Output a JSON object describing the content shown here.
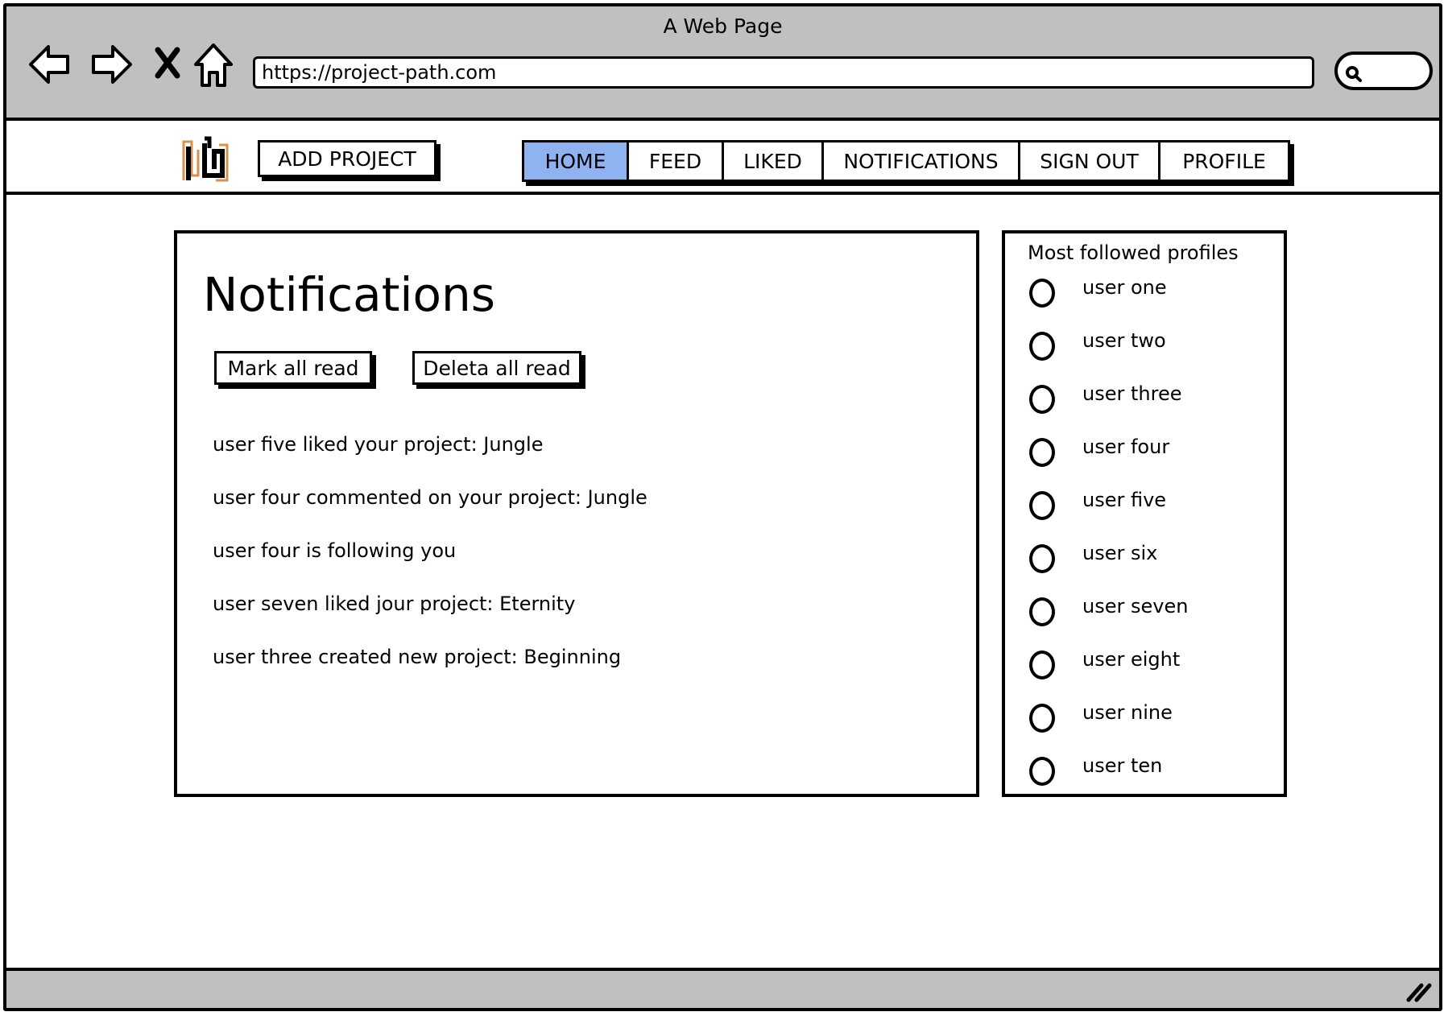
{
  "window": {
    "title": "A Web Page"
  },
  "browser": {
    "back_icon": "back-arrow-icon",
    "forward_icon": "forward-arrow-icon",
    "stop_icon": "close-x-icon",
    "home_icon": "home-icon",
    "url": "https://project-path.com",
    "search_icon": "search-icon"
  },
  "header": {
    "logo": "logo-icon",
    "add_project": "ADD PROJECT",
    "nav": [
      {
        "label": "HOME",
        "active": true
      },
      {
        "label": "FEED",
        "active": false
      },
      {
        "label": "LIKED",
        "active": false
      },
      {
        "label": "NOTIFICATIONS",
        "active": false
      },
      {
        "label": "SIGN OUT",
        "active": false
      },
      {
        "label": "PROFILE",
        "active": false
      }
    ],
    "active_color": "#8fb3f0"
  },
  "main": {
    "title": "Notifications",
    "mark_all_read": "Mark all read",
    "delete_all_read": "Deleta all read",
    "notifications": [
      "user five liked your project: Jungle",
      "user four commented on your project: Jungle",
      "user four is following you",
      "user seven liked jour project: Eternity",
      "user three created new project: Beginning"
    ]
  },
  "sidebar": {
    "title": "Most followed profiles",
    "users": [
      "user one",
      "user two",
      "user three",
      "user four",
      "user five",
      "user six",
      "user seven",
      "user eight",
      "user nine",
      "user ten"
    ]
  }
}
